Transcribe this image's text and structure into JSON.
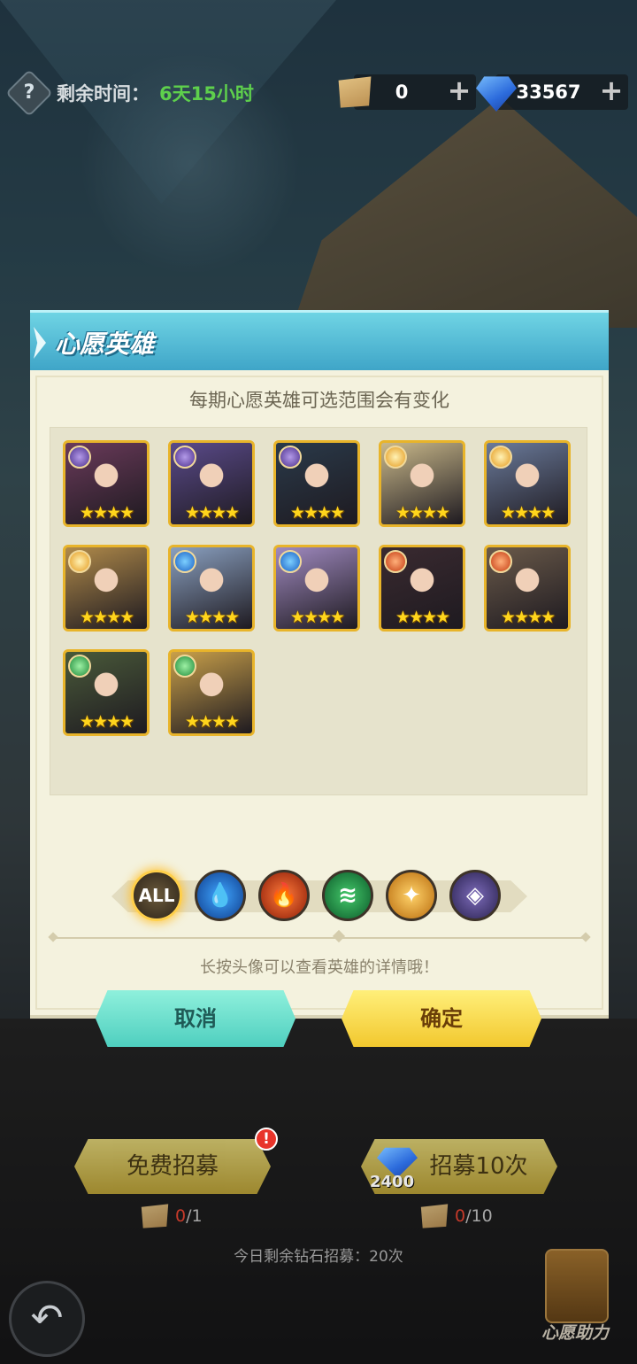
{
  "topbar": {
    "remain_label": "剩余时间：",
    "remain_value": "6天15小时",
    "scroll_count": "0",
    "gem_count": "33567",
    "plus": "+"
  },
  "modal": {
    "title": "心愿英雄",
    "subtitle": "每期心愿英雄可选范围会有变化",
    "hint": "长按头像可以查看英雄的详情哦！",
    "cancel": "取消",
    "confirm": "确定",
    "heroes": [
      {
        "faction": "dark",
        "stars": "★★★★",
        "bg": "#6a3a5a"
      },
      {
        "faction": "dark",
        "stars": "★★★★",
        "bg": "#5a4a8a"
      },
      {
        "faction": "dark",
        "stars": "★★★★",
        "bg": "#2a3a4a"
      },
      {
        "faction": "light",
        "stars": "★★★★",
        "bg": "#c9b88a"
      },
      {
        "faction": "light",
        "stars": "★★★★",
        "bg": "#6a7a9a"
      },
      {
        "faction": "light",
        "stars": "★★★★",
        "bg": "#b08a4a"
      },
      {
        "faction": "water",
        "stars": "★★★★",
        "bg": "#8aa0c0"
      },
      {
        "faction": "water",
        "stars": "★★★★",
        "bg": "#a08ac0"
      },
      {
        "faction": "fire",
        "stars": "★★★★",
        "bg": "#3a2a30"
      },
      {
        "faction": "fire",
        "stars": "★★★★",
        "bg": "#6a5a4a"
      },
      {
        "faction": "wind",
        "stars": "★★★★",
        "bg": "#4a5a3a"
      },
      {
        "faction": "wind",
        "stars": "★★★★",
        "bg": "#c9a04a"
      }
    ],
    "filters": [
      {
        "key": "all",
        "label": "ALL",
        "selected": true
      },
      {
        "key": "water",
        "label": "",
        "selected": false
      },
      {
        "key": "fire",
        "label": "",
        "selected": false
      },
      {
        "key": "wind",
        "label": "",
        "selected": false
      },
      {
        "key": "light",
        "label": "",
        "selected": false
      },
      {
        "key": "dark",
        "label": "",
        "selected": false
      }
    ]
  },
  "bottom": {
    "free_recruit": "免费招募",
    "alert": "!",
    "ten_recruit": "招募10次",
    "ten_cost": "2400",
    "free_count_cur": "0",
    "free_count_tot": "/1",
    "ten_count_cur": "0",
    "ten_count_tot": "/10",
    "today": "今日剩余钻石招募：20次",
    "wish_help": "心愿助力"
  },
  "colors": {
    "accent_teal": "#3fa5c8",
    "confirm_yellow": "#f2c82e",
    "cancel_teal": "#4fcfbf",
    "remain_green": "#5ed04c"
  }
}
